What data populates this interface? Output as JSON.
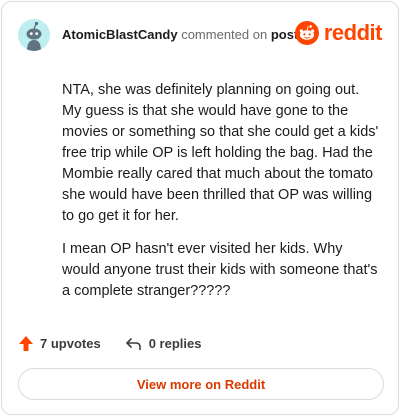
{
  "comment": {
    "author": "AtomicBlastCandy",
    "action_text": "commented on",
    "target_text": "post",
    "paragraphs": [
      "NTA, she was definitely planning on going out. My guess is that she would have gone to the movies or something so that she could get a kids' free trip while OP is left holding the bag. Had the Mombie really cared that much about the tomato she would have been thrilled that OP was willing to go get it for her.",
      "I mean OP hasn't ever visited her kids. Why would anyone trust their kids with someone that's a complete stranger?????"
    ]
  },
  "brand": {
    "name": "reddit",
    "color": "#ff4500"
  },
  "actions": {
    "upvotes_label": "7 upvotes",
    "replies_label": "0 replies"
  },
  "footer": {
    "view_more_label": "View more on Reddit"
  },
  "icons": {
    "avatar": "snoo-avatar-icon",
    "brand": "reddit-logo-icon",
    "upvote": "upvote-arrow-icon",
    "reply": "reply-arrow-icon"
  }
}
